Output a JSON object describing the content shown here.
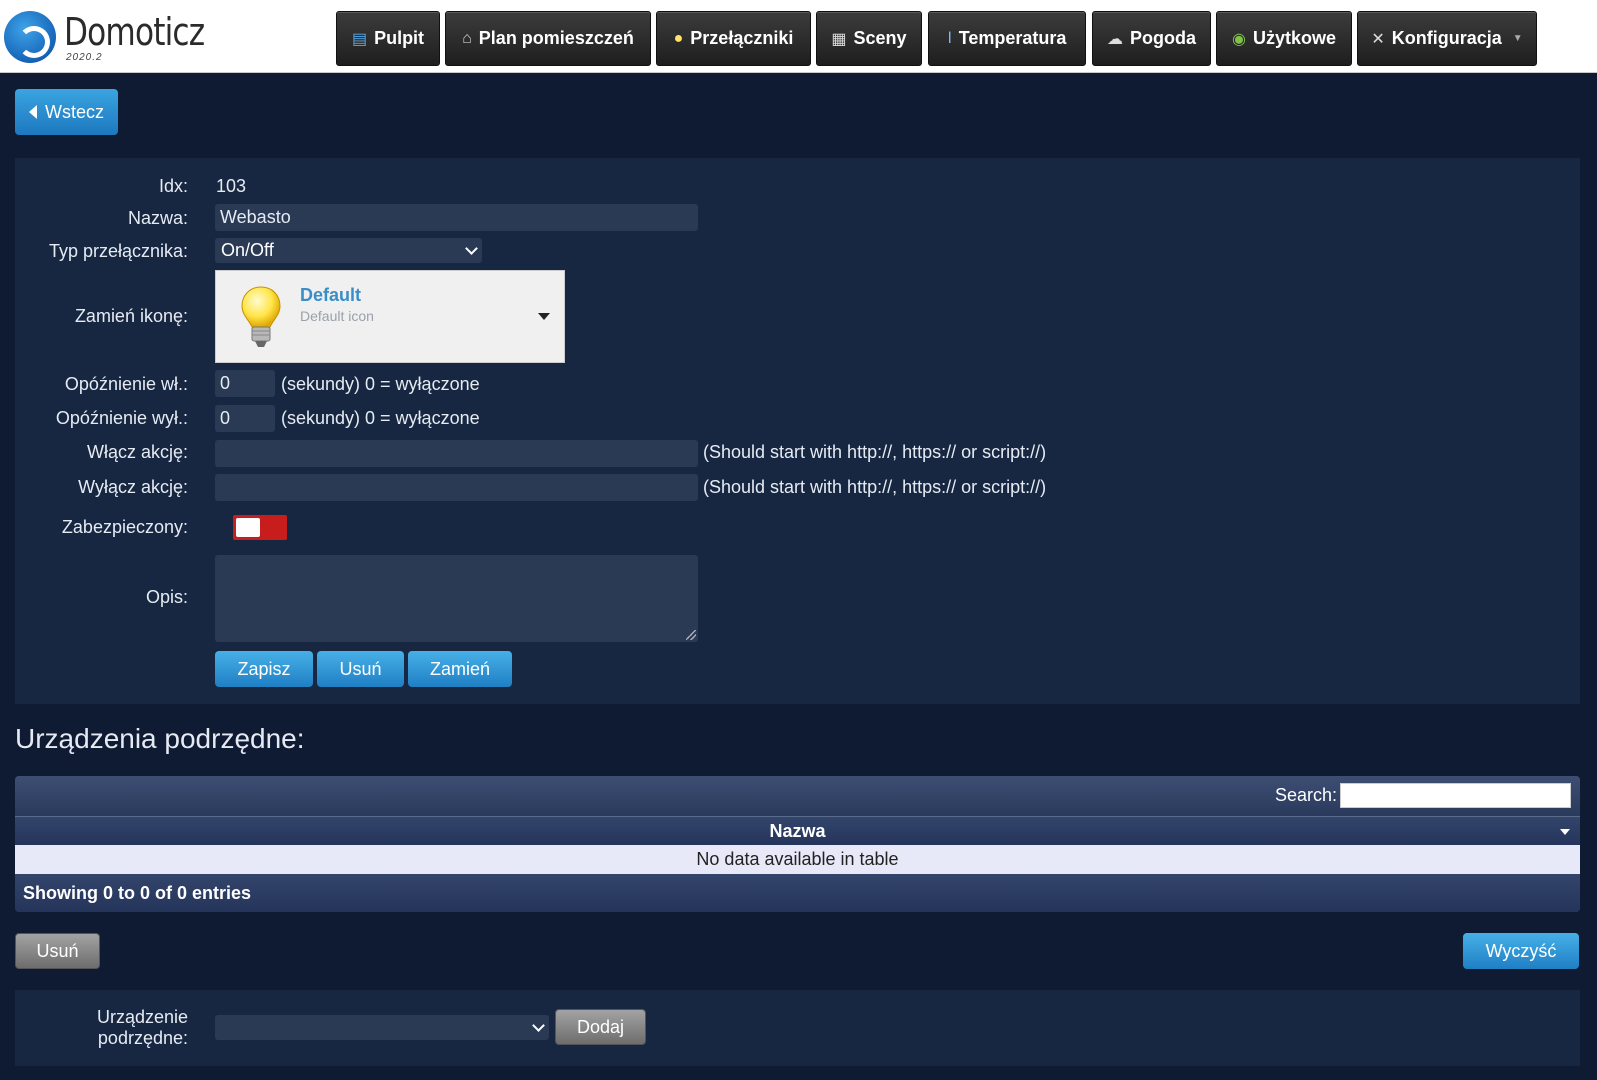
{
  "app": {
    "name": "Domoticz",
    "version": "2020.2"
  },
  "nav": [
    {
      "label": "Pulpit",
      "icon": "dashboard-icon"
    },
    {
      "label": "Plan pomieszczeń",
      "icon": "house-icon"
    },
    {
      "label": "Przełączniki",
      "icon": "bulb-icon"
    },
    {
      "label": "Sceny",
      "icon": "clapper-icon"
    },
    {
      "label": "Temperatura",
      "icon": "thermometer-icon"
    },
    {
      "label": "Pogoda",
      "icon": "cloud-icon"
    },
    {
      "label": "Użytkowe",
      "icon": "globe-icon"
    },
    {
      "label": "Konfiguracja",
      "icon": "tools-icon"
    }
  ],
  "back_label": "Wstecz",
  "form": {
    "idx_label": "Idx:",
    "idx_value": "103",
    "name_label": "Nazwa:",
    "name_value": "Webasto",
    "type_label": "Typ przełącznika:",
    "type_value": "On/Off",
    "icon_label": "Zamień ikonę:",
    "icon_title": "Default",
    "icon_sub": "Default icon",
    "on_delay_label": "Opóźnienie wł.:",
    "on_delay_value": "0",
    "off_delay_label": "Opóźnienie wył.:",
    "off_delay_value": "0",
    "delay_hint": "(sekundy) 0 = wyłączone",
    "on_action_label": "Włącz akcję:",
    "off_action_label": "Wyłącz akcję:",
    "action_hint": "(Should start with http://, https:// or script://)",
    "protected_label": "Zabezpieczony:",
    "description_label": "Opis:",
    "save_label": "Zapisz",
    "delete_label": "Usuń",
    "replace_label": "Zamień"
  },
  "subdevices": {
    "title": "Urządzenia podrzędne:",
    "search_label": "Search:",
    "column": "Nazwa",
    "empty": "No data available in table",
    "footer": "Showing 0 to 0 of 0 entries",
    "delete_label": "Usuń",
    "clear_label": "Wyczyść",
    "add_label_line1": "Urządzenie",
    "add_label_line2": "podrzędne:",
    "add_button": "Dodaj"
  }
}
